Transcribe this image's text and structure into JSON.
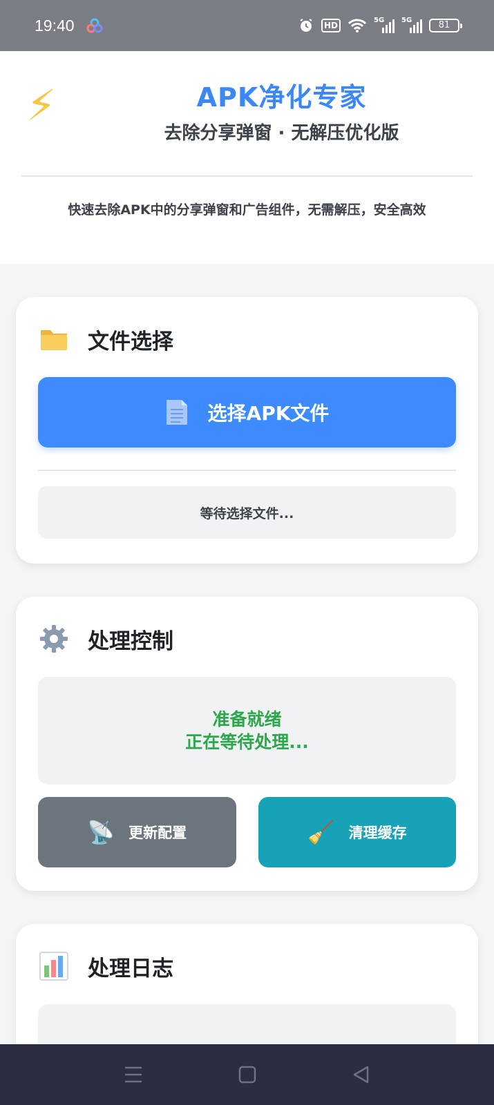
{
  "status_bar": {
    "time": "19:40",
    "hd_label": "HD",
    "signal_1_label": "5G",
    "signal_2_label": "5G",
    "battery": "81"
  },
  "header": {
    "icon": "lightning-bolt-icon",
    "title": "APK净化专家",
    "subtitle": "去除分享弹窗 · 无解压优化版",
    "description": "快速去除APK中的分享弹窗和广告组件，无需解压，安全高效"
  },
  "file_card": {
    "icon": "folder-icon",
    "title": "文件选择",
    "select_button_label": "选择APK文件",
    "status_text": "等待选择文件..."
  },
  "control_card": {
    "icon": "gear-icon",
    "title": "处理控制",
    "status_line_1": "准备就绪",
    "status_line_2": "正在等待处理...",
    "update_button_label": "更新配置",
    "clear_button_label": "清理缓存"
  },
  "log_card": {
    "icon": "bar-chart-icon",
    "title": "处理日志"
  },
  "colors": {
    "accent": "#3d8bff",
    "title": "#3b87f5",
    "success": "#2aa84a",
    "gray_button": "#6c757d",
    "teal_button": "#17a2b8",
    "nav_bar": "#2b2d42",
    "status_bar": "#7a7e84"
  }
}
